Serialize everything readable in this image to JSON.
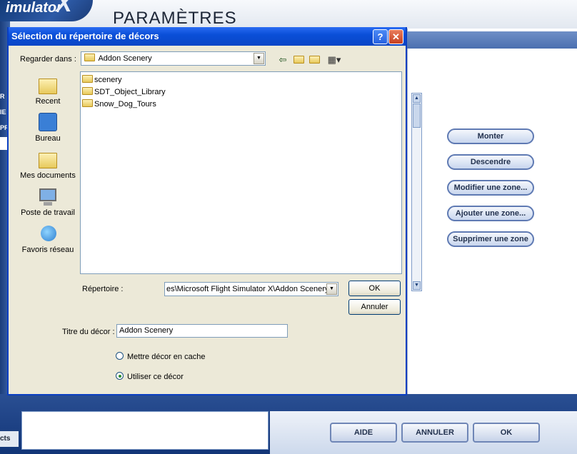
{
  "background": {
    "logo_text": "imulator",
    "logo_x": "X",
    "page_title": "PARAMÈTRES",
    "left_strip_letters": [
      "R",
      "IE",
      "PR"
    ],
    "side_buttons": [
      "Monter",
      "Descendre",
      "Modifier une zone...",
      "Ajouter une zone...",
      "Supprimer une zone"
    ],
    "bottom_tab": "cts",
    "bottom_buttons": {
      "help": "AIDE",
      "cancel": "ANNULER",
      "ok": "OK"
    }
  },
  "dialog": {
    "title": "Sélection du répertoire de décors",
    "help_btn": "?",
    "close_btn": "✕",
    "look_in_label": "Regarder dans :",
    "look_in_value": "Addon Scenery",
    "places": [
      {
        "label": "Recent",
        "icon": "recent-folder-icon"
      },
      {
        "label": "Bureau",
        "icon": "desktop-icon"
      },
      {
        "label": "Mes documents",
        "icon": "my-documents-icon"
      },
      {
        "label": "Poste de travail",
        "icon": "my-computer-icon"
      },
      {
        "label": "Favoris réseau",
        "icon": "network-places-icon"
      }
    ],
    "files": [
      "scenery",
      "SDT_Object_Library",
      "Snow_Dog_Tours"
    ],
    "directory_label": "Répertoire :",
    "directory_value": "es\\Microsoft Flight Simulator X\\Addon Scenery",
    "ok_label": "OK",
    "cancel_label": "Annuler",
    "scenery_title_label": "Titre du décor :",
    "scenery_title_value": "Addon Scenery",
    "radio_cache": "Mettre décor en cache",
    "radio_use": "Utiliser ce décor",
    "selected_radio": "radio_use"
  }
}
